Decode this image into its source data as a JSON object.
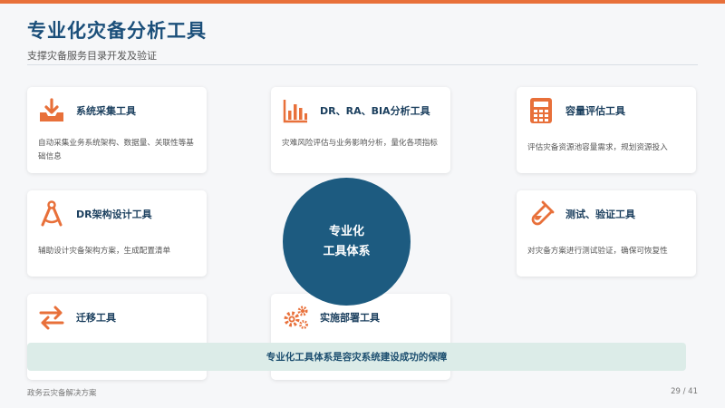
{
  "header": {
    "title": "专业化灾备分析工具",
    "subtitle": "支撑灾备服务目录开发及验证"
  },
  "colors": {
    "accent": "#e8703a",
    "primary": "#1d5b80",
    "banner_bg": "#dcece8"
  },
  "cards": {
    "collect": {
      "title": "系统采集工具",
      "desc": "自动采集业务系统架构、数据量、关联性等基础信息",
      "icon": "download-tray-icon"
    },
    "analysis": {
      "title": "DR、RA、BIA分析工具",
      "desc": "灾难风险评估与业务影响分析，量化各项指标",
      "icon": "bar-chart-icon"
    },
    "capacity": {
      "title": "容量评估工具",
      "desc": "评估灾备资源池容量需求，规划资源投入",
      "icon": "calculator-icon"
    },
    "design": {
      "title": "DR架构设计工具",
      "desc": "辅助设计灾备架构方案，生成配置清单",
      "icon": "compass-icon"
    },
    "test": {
      "title": "测试、验证工具",
      "desc": "对灾备方案进行测试验证，确保可恢复性",
      "icon": "test-tube-icon"
    },
    "migrate": {
      "title": "迁移工具",
      "icon": "exchange-arrows-icon"
    },
    "deploy": {
      "title": "实施部署工具",
      "icon": "gears-icon"
    }
  },
  "center": {
    "line1": "专业化",
    "line2": "工具体系"
  },
  "banner": {
    "text": "专业化工具体系是容灾系统建设成功的保障"
  },
  "footer": {
    "left": "政务云灾备解决方案",
    "page": "29 / 41"
  }
}
